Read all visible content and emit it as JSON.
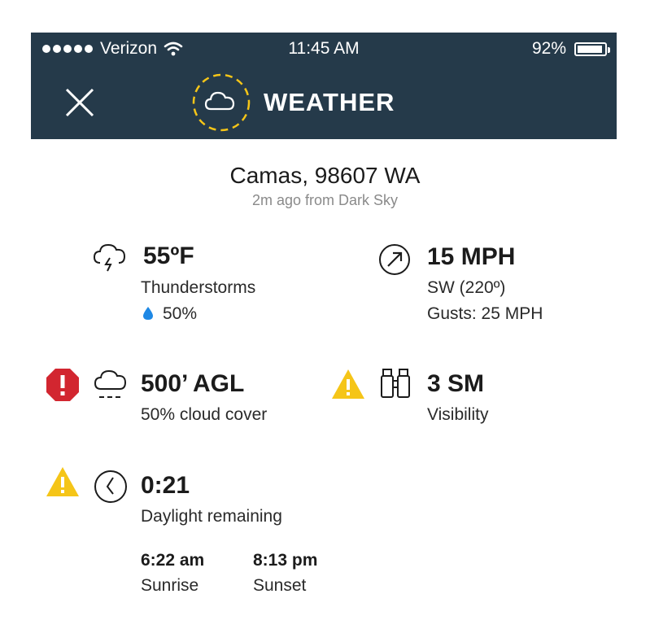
{
  "status_bar": {
    "carrier": "Verizon",
    "time": "11:45 AM",
    "battery": "92%"
  },
  "nav": {
    "title": "WEATHER",
    "close_icon": "close-icon",
    "title_icon": "cloud-icon"
  },
  "location": {
    "name": "Camas, 98607 WA",
    "updated": "2m ago from Dark Sky"
  },
  "temperature": {
    "value": "55ºF",
    "condition": "Thunderstorms",
    "precip": "50%",
    "icon": "thunderstorm-icon"
  },
  "wind": {
    "speed": "15 MPH",
    "direction": "SW (220º)",
    "gusts": "Gusts: 25 MPH",
    "icon": "wind-direction-icon"
  },
  "ceiling": {
    "value": "500’ AGL",
    "label": "50% cloud cover",
    "icon": "cloud-ceiling-icon",
    "alert": "danger"
  },
  "visibility": {
    "value": "3 SM",
    "label": "Visibility",
    "icon": "binoculars-icon",
    "alert": "warning"
  },
  "daylight": {
    "value": "0:21",
    "label": "Daylight remaining",
    "icon": "clock-icon",
    "alert": "warning",
    "sunrise_time": "6:22 am",
    "sunrise_label": "Sunrise",
    "sunset_time": "8:13 pm",
    "sunset_label": "Sunset"
  },
  "colors": {
    "navbar": "#253a4a",
    "accent_yellow": "#f5c518",
    "danger_red": "#d22630",
    "rain_blue": "#1e88e5"
  }
}
